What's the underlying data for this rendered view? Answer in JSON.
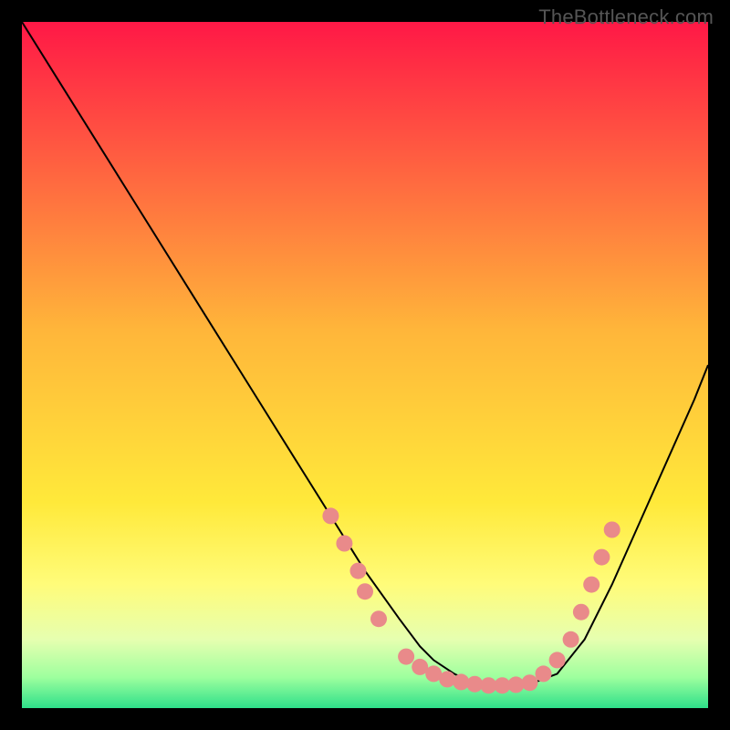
{
  "watermark": "TheBottleneck.com",
  "chart_data": {
    "type": "line",
    "title": "",
    "xlabel": "",
    "ylabel": "",
    "xlim": [
      0,
      100
    ],
    "ylim": [
      0,
      100
    ],
    "grid": false,
    "legend": false,
    "background_gradient": {
      "stops": [
        {
          "offset": 0.0,
          "color": "#ff1846"
        },
        {
          "offset": 0.45,
          "color": "#ffb63a"
        },
        {
          "offset": 0.7,
          "color": "#ffe93a"
        },
        {
          "offset": 0.82,
          "color": "#fffc7a"
        },
        {
          "offset": 0.9,
          "color": "#e6ffb0"
        },
        {
          "offset": 0.955,
          "color": "#9eff9e"
        },
        {
          "offset": 1.0,
          "color": "#2ee08a"
        }
      ]
    },
    "series": [
      {
        "name": "bottleneck-curve",
        "x": [
          0,
          5,
          10,
          15,
          20,
          25,
          30,
          35,
          40,
          45,
          50,
          55,
          58,
          60,
          63,
          65,
          68,
          71,
          74,
          78,
          82,
          86,
          90,
          94,
          98,
          100
        ],
        "y": [
          100,
          92,
          84,
          76,
          68,
          60,
          52,
          44,
          36,
          28,
          20,
          13,
          9,
          7,
          5,
          4,
          3.5,
          3.3,
          3.5,
          5,
          10,
          18,
          27,
          36,
          45,
          50
        ]
      }
    ],
    "markers": {
      "name": "highlight-points",
      "color": "#e98a8a",
      "radius": 9,
      "points": [
        {
          "x": 45,
          "y": 28
        },
        {
          "x": 47,
          "y": 24
        },
        {
          "x": 49,
          "y": 20
        },
        {
          "x": 50,
          "y": 17
        },
        {
          "x": 52,
          "y": 13
        },
        {
          "x": 56,
          "y": 7.5
        },
        {
          "x": 58,
          "y": 6
        },
        {
          "x": 60,
          "y": 5
        },
        {
          "x": 62,
          "y": 4.2
        },
        {
          "x": 64,
          "y": 3.8
        },
        {
          "x": 66,
          "y": 3.5
        },
        {
          "x": 68,
          "y": 3.3
        },
        {
          "x": 70,
          "y": 3.3
        },
        {
          "x": 72,
          "y": 3.4
        },
        {
          "x": 74,
          "y": 3.7
        },
        {
          "x": 76,
          "y": 5
        },
        {
          "x": 78,
          "y": 7
        },
        {
          "x": 80,
          "y": 10
        },
        {
          "x": 81.5,
          "y": 14
        },
        {
          "x": 83,
          "y": 18
        },
        {
          "x": 84.5,
          "y": 22
        },
        {
          "x": 86,
          "y": 26
        }
      ]
    }
  }
}
